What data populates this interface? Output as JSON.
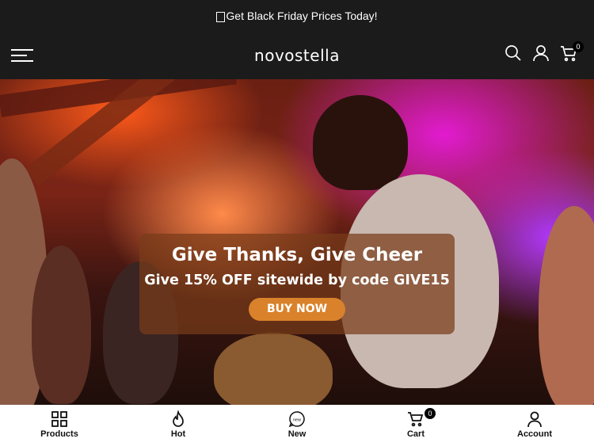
{
  "announcement": {
    "text": "Get Black Friday Prices Today!"
  },
  "header": {
    "logo": "novostella",
    "cart_count": "0"
  },
  "banner": {
    "headline": "Give Thanks, Give Cheer",
    "subline": "Give 15% OFF sitewide by code GIVE15",
    "button_label": "BUY NOW",
    "icons": [
      "menu-icon",
      "search-icon",
      "user-icon",
      "cart-icon"
    ]
  },
  "bottom_nav": {
    "items": [
      {
        "label": "Products",
        "icon": "grid-icon"
      },
      {
        "label": "Hot",
        "icon": "flame-icon"
      },
      {
        "label": "New",
        "icon": "new-badge-icon"
      },
      {
        "label": "Cart",
        "icon": "cart-icon",
        "badge": "0"
      },
      {
        "label": "Account",
        "icon": "user-icon"
      }
    ]
  },
  "colors": {
    "topbar_bg": "#1b1b1b",
    "button_bg": "#d9822b",
    "promo_bg": "#783c19",
    "nav_bg": "#ffffff"
  }
}
